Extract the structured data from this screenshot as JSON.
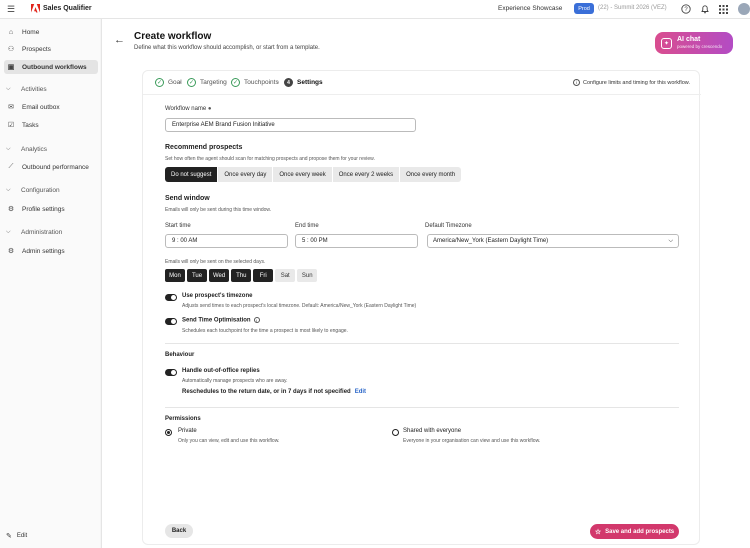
{
  "topbar": {
    "app_name": "Sales Qualifier",
    "showcase": "Experience Showcase",
    "env_badge": "Prod",
    "env_text": "(22) - Summit 2026 (VEZ)",
    "icons": [
      "help-icon",
      "bell-icon",
      "apps-grid-icon",
      "avatar"
    ]
  },
  "sidebar": {
    "items": [
      {
        "label": "Home",
        "icon": "home-icon"
      },
      {
        "label": "Prospects",
        "icon": "people-icon"
      },
      {
        "label": "Outbound workflows",
        "icon": "workflow-icon"
      }
    ],
    "sections": [
      {
        "label": "Activities",
        "items": [
          {
            "label": "Email outbox",
            "icon": "mail-icon"
          },
          {
            "label": "Tasks",
            "icon": "tasks-icon"
          }
        ]
      },
      {
        "label": "Analytics",
        "items": [
          {
            "label": "Outbound performance",
            "icon": "chart-icon"
          }
        ]
      },
      {
        "label": "Configuration",
        "items": [
          {
            "label": "Profile settings",
            "icon": "profile-icon"
          }
        ]
      },
      {
        "label": "Administration",
        "items": [
          {
            "label": "Admin settings",
            "icon": "gear-icon"
          }
        ]
      }
    ],
    "edit_label": "Edit"
  },
  "header": {
    "title": "Create workflow",
    "subtitle": "Define what this workflow should accomplish, or start from a template.",
    "ai_chat_label": "AI chat",
    "ai_chat_sub": "powered by crescendo"
  },
  "steps": {
    "items": [
      {
        "label": "Goal",
        "state": "done"
      },
      {
        "label": "Targeting",
        "state": "done"
      },
      {
        "label": "Touchpoints",
        "state": "done"
      },
      {
        "label": "Settings",
        "state": "current",
        "number": "4"
      }
    ],
    "configure_text": "Configure limits and timing for this workflow."
  },
  "form": {
    "workflow_name_label": "Workflow name",
    "workflow_name_value": "Enterprise AEM Brand Fusion Initiative",
    "recommend_title": "Recommend prospects",
    "recommend_helper": "Set how often the agent should scan for matching prospects and propose them for your review.",
    "recommend_options": [
      "Do not suggest",
      "Once every day",
      "Once every week",
      "Once every 2 weeks",
      "Once every month"
    ],
    "recommend_selected": 0,
    "send_window_title": "Send window",
    "send_window_helper": "Emails will only be sent during this time window.",
    "start_time_label": "Start time",
    "start_time_value": "9 : 00  AM",
    "end_time_label": "End time",
    "end_time_value": "5 : 00  PM",
    "timezone_label": "Default Timezone",
    "timezone_value": "America/New_York (Eastern Daylight Time)",
    "days_helper": "Emails will only be sent on the selected days.",
    "days": [
      {
        "label": "Mon",
        "on": true
      },
      {
        "label": "Tue",
        "on": true
      },
      {
        "label": "Wed",
        "on": true
      },
      {
        "label": "Thu",
        "on": true
      },
      {
        "label": "Fri",
        "on": true
      },
      {
        "label": "Sat",
        "on": false
      },
      {
        "label": "Sun",
        "on": false
      }
    ],
    "use_tz_label": "Use prospect's timezone",
    "use_tz_helper": "Adjusts send times to each prospect's local timezone. Default: America/New_York (Eastern Daylight Time)",
    "sto_label": "Send Time Optimisation",
    "sto_helper": "Schedules each touchpoint for the time a prospect is most likely to engage.",
    "behaviour_title": "Behaviour",
    "ooo_label": "Handle out-of-office replies",
    "ooo_helper": "Automatically manage prospects who are away.",
    "ooo_rule": "Reschedules to the return date, or in 7 days if not specified",
    "ooo_edit": "Edit",
    "permissions_title": "Permissions",
    "private_label": "Private",
    "private_helper": "Only you can view, edit and use this workflow.",
    "shared_label": "Shared with everyone",
    "shared_helper": "Everyone in your organisation can view and use this workflow."
  },
  "footer": {
    "back_label": "Back",
    "save_label": "Save and add prospects"
  }
}
